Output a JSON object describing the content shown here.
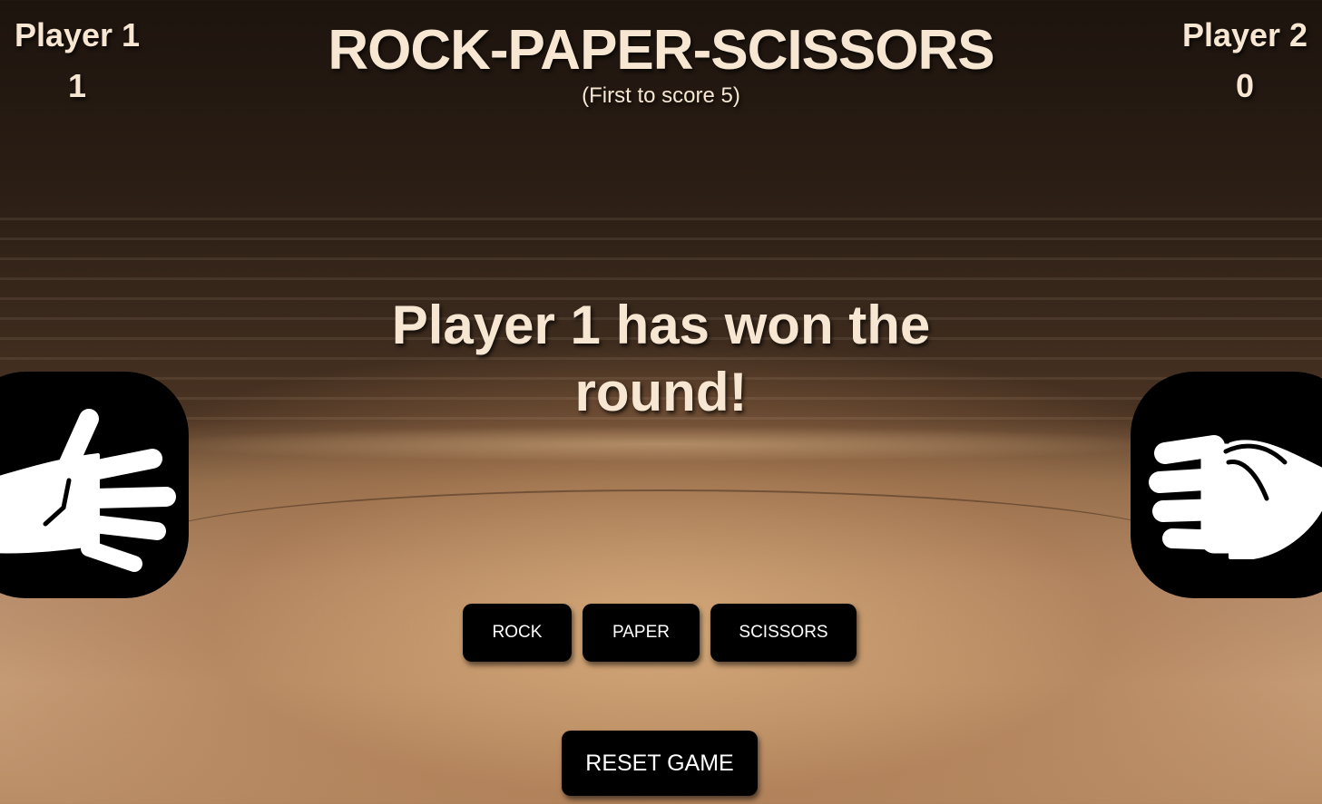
{
  "title": "ROCK-PAPER-SCISSORS",
  "subtitle": "(First to score 5)",
  "players": [
    {
      "name": "Player 1",
      "score": "1"
    },
    {
      "name": "Player 2",
      "score": "0"
    }
  ],
  "message": "Player 1 has won the round!",
  "hands": {
    "left": "paper-hand-icon",
    "right": "rock-hand-icon"
  },
  "buttons": {
    "rock": "ROCK",
    "paper": "PAPER",
    "scissors": "SCISSORS",
    "reset": "RESET GAME"
  },
  "colors": {
    "text": "#f6e6d2",
    "button": "#000000",
    "button_text": "#ffffff"
  }
}
